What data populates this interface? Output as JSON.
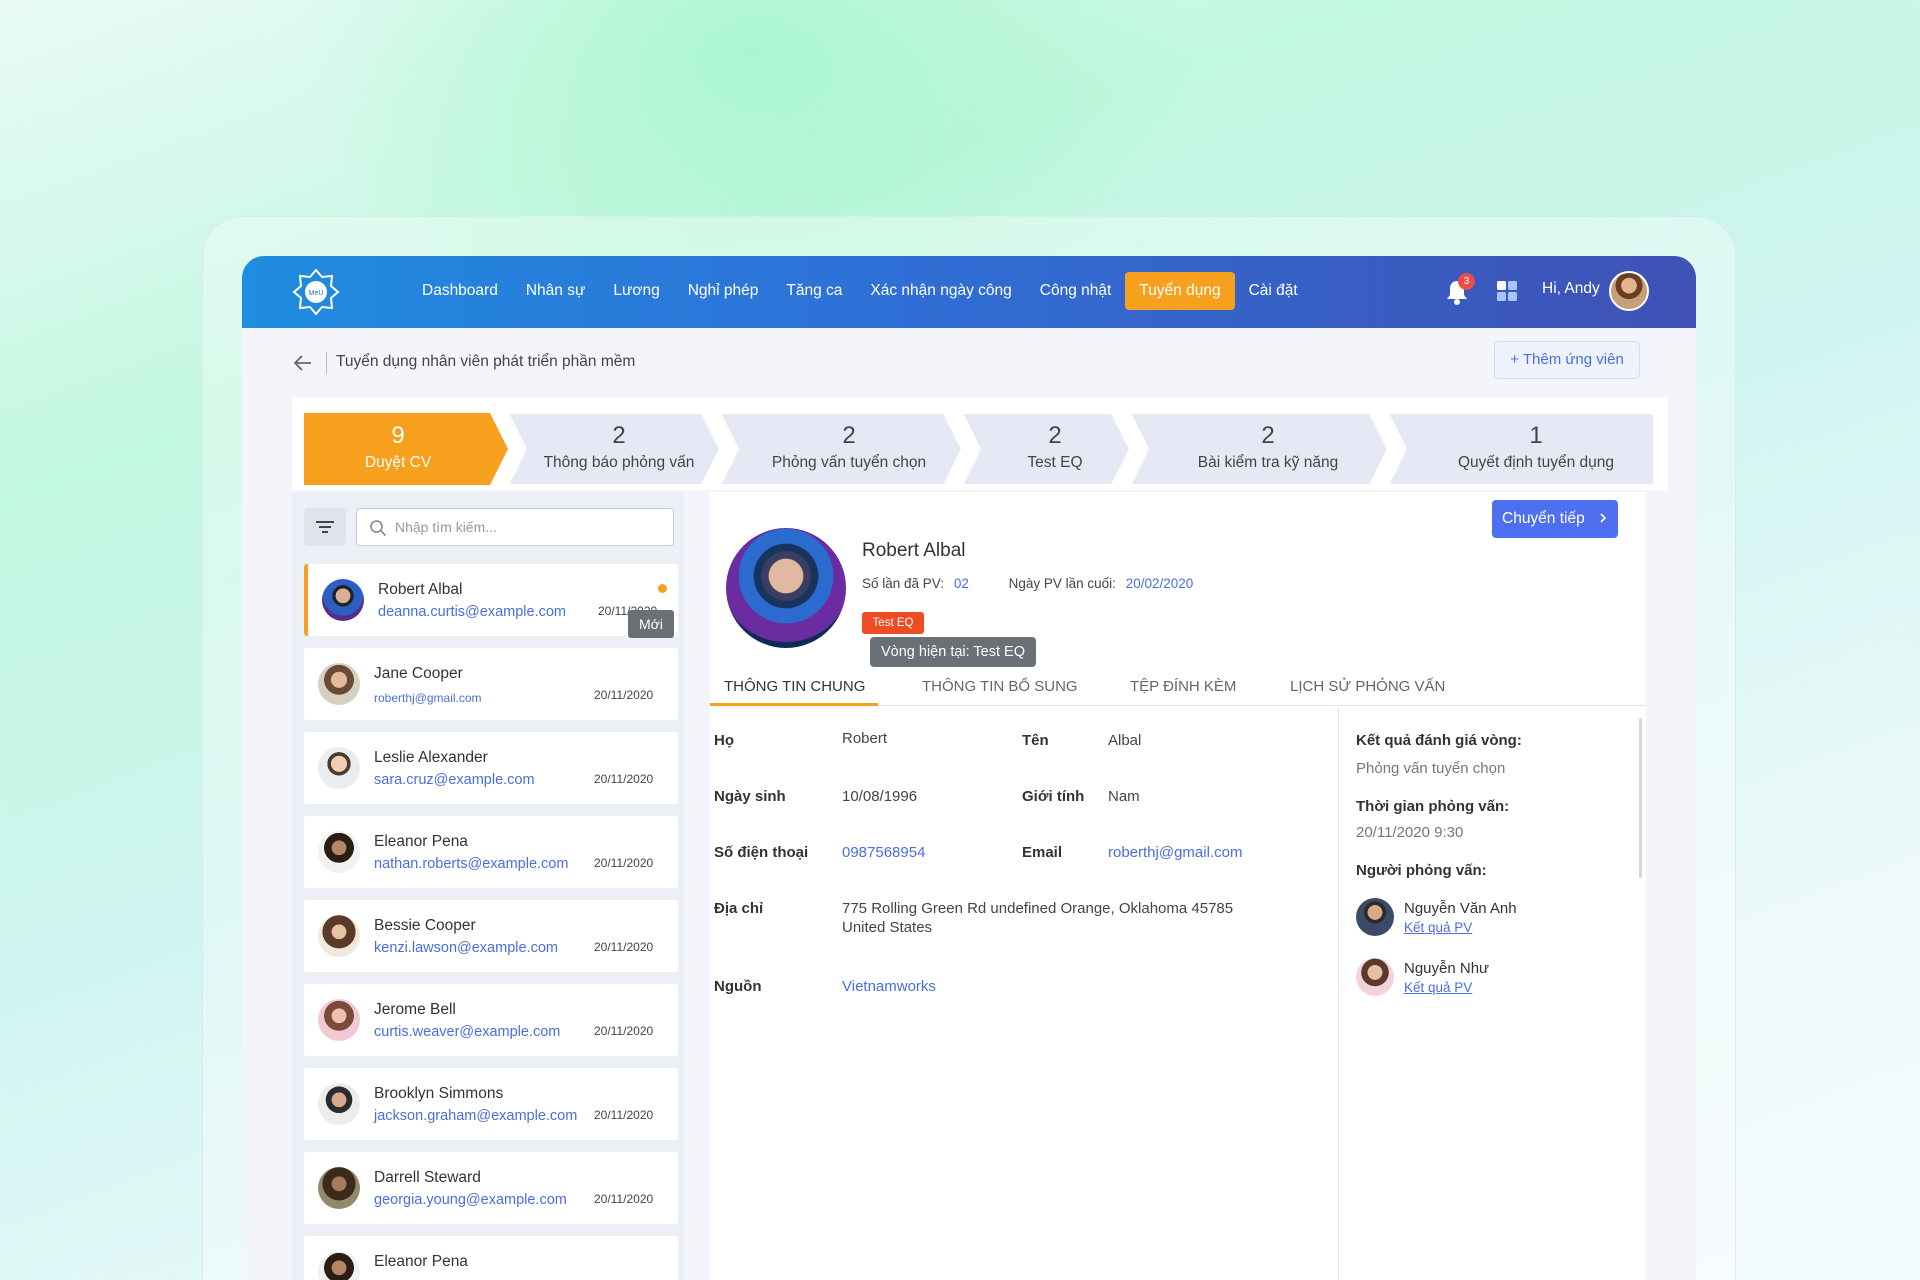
{
  "header": {
    "logo_text": "MeU",
    "nav": [
      "Dashboard",
      "Nhân sự",
      "Lương",
      "Nghỉ phép",
      "Tăng ca",
      "Xác nhận ngày công",
      "Công nhật",
      "Tuyển dụng",
      "Cài đặt"
    ],
    "active_nav": "Tuyển dụng",
    "notifications_count": "3",
    "greeting": "Hi, Andy"
  },
  "breadcrumb": {
    "title": "Tuyển dụng nhân viên phát triển phần mềm"
  },
  "add_candidate_label": "Thêm ứng viên",
  "pipeline": [
    {
      "count": "9",
      "label": "Duyệt CV"
    },
    {
      "count": "2",
      "label": "Thông báo phỏng vấn"
    },
    {
      "count": "2",
      "label": "Phỏng vấn tuyển chọn"
    },
    {
      "count": "2",
      "label": "Test EQ"
    },
    {
      "count": "2",
      "label": "Bài kiểm tra kỹ năng"
    },
    {
      "count": "1",
      "label": "Quyết định tuyển dụng"
    }
  ],
  "search": {
    "placeholder": "Nhập tìm kiếm..."
  },
  "new_tooltip": "Mới",
  "candidates": [
    {
      "name": "Robert Albal",
      "email": "deanna.curtis@example.com",
      "date": "20/11/2020"
    },
    {
      "name": "Jane Cooper",
      "email": "roberthj@gmail.com",
      "date": "20/11/2020"
    },
    {
      "name": "Leslie Alexander",
      "email": "sara.cruz@example.com",
      "date": "20/11/2020"
    },
    {
      "name": "Eleanor Pena",
      "email": "nathan.roberts@example.com",
      "date": "20/11/2020"
    },
    {
      "name": "Bessie Cooper",
      "email": "kenzi.lawson@example.com",
      "date": "20/11/2020"
    },
    {
      "name": "Jerome Bell",
      "email": "curtis.weaver@example.com",
      "date": "20/11/2020"
    },
    {
      "name": "Brooklyn Simmons",
      "email": "jackson.graham@example.com",
      "date": "20/11/2020"
    },
    {
      "name": "Darrell Steward",
      "email": "georgia.young@example.com",
      "date": "20/11/2020"
    },
    {
      "name": "Eleanor Pena",
      "email": "",
      "date": ""
    }
  ],
  "profile": {
    "next_button": "Chuyển tiếp",
    "name": "Robert Albal",
    "interviews_label": "Số lần đã PV:",
    "interviews_value": "02",
    "last_interview_label": "Ngày PV lần cuối:",
    "last_interview_value": "20/02/2020",
    "tag": "Test EQ",
    "round_tooltip": "Vòng hiện tại: Test EQ",
    "tabs": [
      "THÔNG TIN CHUNG",
      "THÔNG TIN BỔ SUNG",
      "TỆP ĐÍNH KÈM",
      "LỊCH SỬ PHỎNG VẤN"
    ],
    "fields": {
      "last_name_label": "Họ",
      "last_name": "Robert",
      "first_name_label": "Tên",
      "first_name": "Albal",
      "dob_label": "Ngày sinh",
      "dob": "10/08/1996",
      "gender_label": "Giới tính",
      "gender": "Nam",
      "phone_label": "Số điện thoại",
      "phone": "0987568954",
      "email_label": "Email",
      "email": "roberthj@gmail.com",
      "address_label": "Địa chỉ",
      "address_line1": "775 Rolling Green Rd undefined Orange, Oklahoma 45785",
      "address_line2": "United States",
      "source_label": "Nguồn",
      "source": "Vietnamworks"
    },
    "result": {
      "eval_label": "Kết quả đánh giá vòng:",
      "eval_value": "Phỏng vấn tuyển chọn",
      "time_label": "Thời gian phỏng vấn:",
      "time_value": "20/11/2020 9:30",
      "interviewers_label": "Người phỏng vấn:",
      "interviewers": [
        {
          "name": "Nguyễn Văn Anh",
          "link": "Kết quả PV"
        },
        {
          "name": "Nguyễn Như",
          "link": "Kết quả PV"
        }
      ]
    }
  },
  "colors": {
    "primary": "#4d6ff0",
    "accent": "#f7a01d",
    "tag": "#ef4b24",
    "header_start": "#1f8de0",
    "header_end": "#3f51b5"
  }
}
